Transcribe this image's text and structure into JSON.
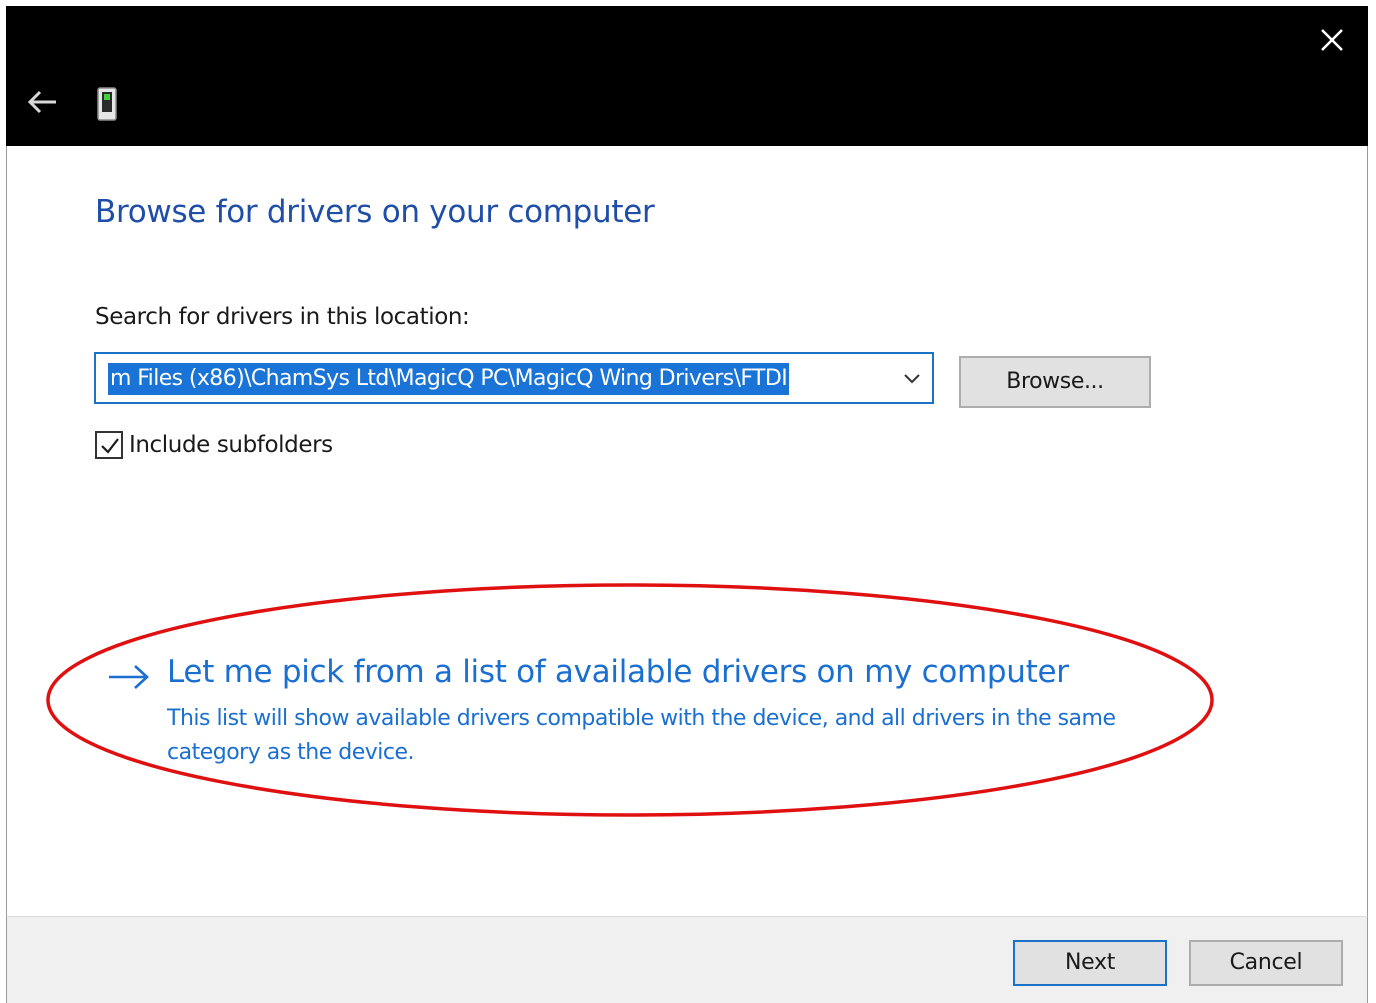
{
  "titlebar": {
    "close_icon": "close-icon",
    "back_icon": "back-arrow-icon",
    "device_icon": "device-icon"
  },
  "page": {
    "title": "Browse for drivers on your computer",
    "location_label": "Search for drivers in this location:",
    "path_value": "m Files (x86)\\ChamSys Ltd\\MagicQ PC\\MagicQ Wing Drivers\\FTDI",
    "browse_label": "Browse...",
    "include_subfolders_label": "Include subfolders",
    "include_subfolders_checked": true
  },
  "pick_option": {
    "title": "Let me pick from a list of available drivers on my computer",
    "description": "This list will show available drivers compatible with the device, and all drivers in the same category as the device."
  },
  "footer": {
    "next_label": "Next",
    "cancel_label": "Cancel"
  },
  "colors": {
    "titlebar": "#000000",
    "title_text": "#1f4ea8",
    "link_text": "#1a6fd0",
    "selection": "#1a73d6",
    "annotation": "#e01010"
  }
}
